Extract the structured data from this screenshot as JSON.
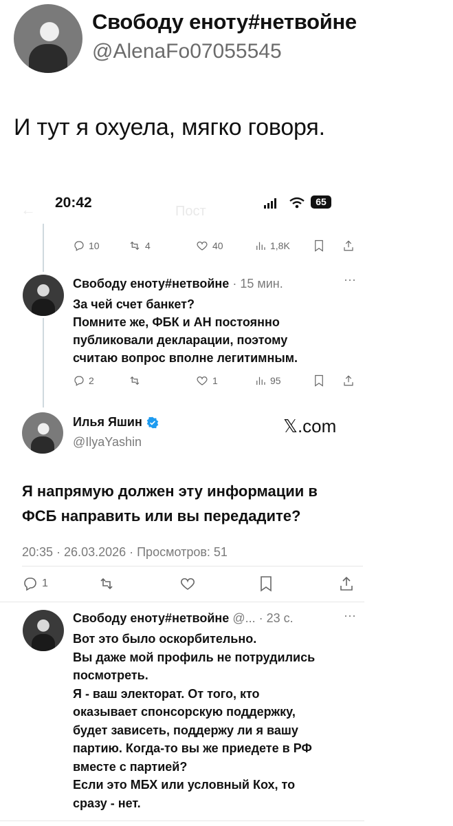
{
  "outer_tweet": {
    "display_name": "Свободу еноту#нетвойне",
    "handle": "@AlenaFo07055545",
    "text": "И тут я охуела, мягко говоря."
  },
  "status_bar": {
    "time": "20:42",
    "battery": "65",
    "faded_title": "Пост"
  },
  "top_actions": {
    "replies": "10",
    "reposts": "4",
    "likes": "40",
    "views": "1,8K"
  },
  "reply1": {
    "display_name": "Свободу еноту#нетвойне",
    "time": "· 15 мин.",
    "lines": [
      "За чей счет банкет?",
      "Помните же, ФБК и АН постоянно",
      "публиковали декларации, поэтому",
      "считаю вопрос вполне легитимным."
    ],
    "replies": "2",
    "reposts": "",
    "likes": "1",
    "views": "95"
  },
  "main_tweet": {
    "display_name": "Илья Яшин",
    "handle": "@IlyaYashin",
    "watermark": "𝕏.com",
    "lines": [
      "Я напрямую должен эту информации в",
      "ФСБ направить или вы передадите?"
    ],
    "meta": "20:35 · 26.03.2026 · Просмотров: 51",
    "replies": "1"
  },
  "reply2": {
    "display_name": "Свободу еноту#нетвойне",
    "handle_time": "@... · 23 с.",
    "lines": [
      "Вот это было оскорбительно.",
      "Вы даже мой профиль не потрудились",
      "посмотреть.",
      "Я - ваш электорат. От того, кто",
      "оказывает спонсорскую поддержку,",
      "будет зависеть, поддержу ли я вашу",
      "партию. Когда-то вы же приедете в РФ",
      "вместе с партией?",
      "Если это МБХ или условный Кох, то",
      "сразу - нет."
    ]
  },
  "icons": [
    "reply-icon",
    "repost-icon",
    "like-icon",
    "views-icon",
    "bookmark-icon",
    "share-icon",
    "verified-badge-icon",
    "more-icon",
    "signal-icon",
    "wifi-icon",
    "battery-icon",
    "back-arrow-icon"
  ]
}
